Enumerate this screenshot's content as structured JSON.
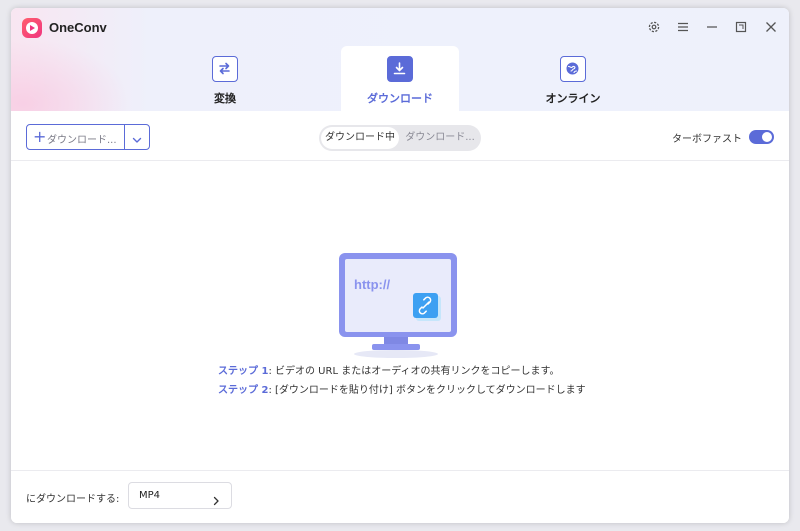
{
  "app": {
    "title": "OneConv"
  },
  "tabs": [
    {
      "label": "変換",
      "icon": "swap-arrows-icon",
      "active": false
    },
    {
      "label": "ダウンロード",
      "icon": "download-icon",
      "active": true
    },
    {
      "label": "オンライン",
      "icon": "globe-icon",
      "active": false
    }
  ],
  "toolbar": {
    "add_label": "ダウンロード...",
    "add_plus": "+",
    "segment_active": "ダウンロード中",
    "segment_inactive": "ダウンロード...",
    "turbo_label": "ターボファスト",
    "turbo_enabled": true
  },
  "main": {
    "url_text": "http://",
    "step1_key": "ステップ 1",
    "step1_text": ": ビデオの URL またはオーディオの共有リンクをコピーします。",
    "step2_key": "ステップ 2",
    "step2_text": ": [ダウンロードを貼り付け] ボタンをクリックしてダウンロードします"
  },
  "footer": {
    "label": "にダウンロードする:",
    "format_value": "MP4"
  },
  "colors": {
    "accent": "#5b6bd8",
    "logo": "#f0357f"
  }
}
